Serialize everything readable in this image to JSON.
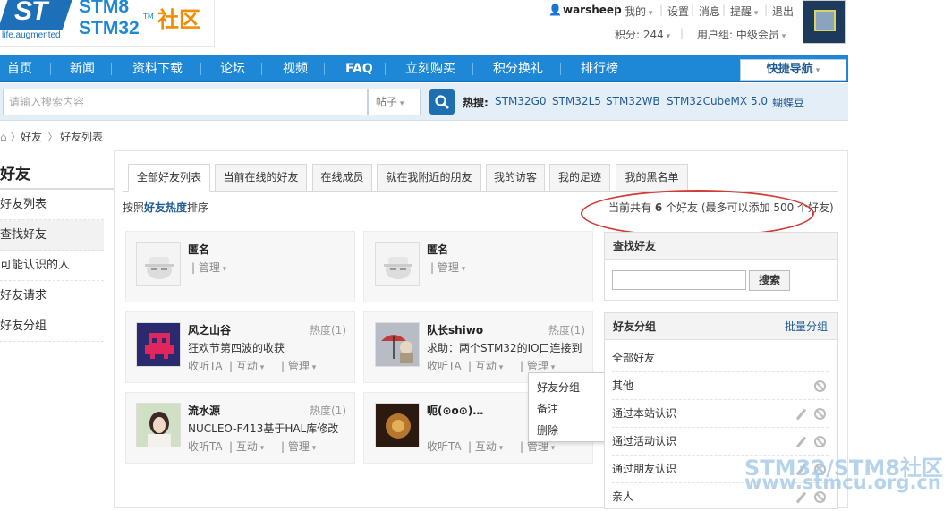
{
  "header": {
    "logo_text": "ST",
    "logo_tagline": "life.augmented",
    "brand_line1": "STM8",
    "brand_line2": "STM32",
    "brand_tm": "TM",
    "brand_cn": "社区",
    "username": "warsheep",
    "my": "我的",
    "settings": "设置",
    "messages": "消息",
    "remind": "提醒",
    "logout": "退出",
    "points": "积分: 244",
    "usergroup": "用户组: 中级会员"
  },
  "nav": {
    "items": [
      "首页",
      "新闻",
      "资料下载",
      "论坛",
      "视频",
      "FAQ",
      "立刻购买",
      "积分换礼",
      "排行榜"
    ],
    "quick": "快捷导航"
  },
  "search": {
    "placeholder": "请输入搜索内容",
    "scope": "帖子",
    "hot_label": "热搜:",
    "hot": [
      "STM32G0",
      "STM32L5",
      "STM32WB",
      "STM32CubeMX 5.0",
      "蝴蝶豆"
    ]
  },
  "breadcrumb": [
    "好友",
    "好友列表"
  ],
  "left": {
    "title": "好友",
    "items": [
      "好友列表",
      "查找好友",
      "可能认识的人",
      "好友请求",
      "好友分组"
    ]
  },
  "tabs": [
    "全部好友列表",
    "当前在线的好友",
    "在线成员",
    "就在我附近的朋友",
    "我的访客",
    "我的足迹",
    "我的黑名单"
  ],
  "sort": {
    "prefix": "按照",
    "key": "好友热度",
    "suffix": "排序"
  },
  "count": {
    "prefix": "当前共有",
    "num": "6",
    "mid": "个好友 (最多可以添加 500 个好友)"
  },
  "friends": [
    {
      "name": "匿名",
      "manage": "管理"
    },
    {
      "name": "匿名",
      "manage": "管理"
    },
    {
      "name": "风之山谷",
      "heat": "热度(1)",
      "desc": "狂欢节第四波的收获",
      "listen": "收听TA",
      "interact": "互动",
      "manage": "管理"
    },
    {
      "name": "队长shiwo",
      "heat": "热度(1)",
      "desc": "求助：两个STM32的IO口连接到",
      "listen": "收听TA",
      "interact": "互动",
      "manage": "管理"
    },
    {
      "name": "流水源",
      "heat": "热度(1)",
      "desc": "NUCLEO-F413基于HAL库修改",
      "listen": "收听TA",
      "interact": "互动",
      "manage": "管理"
    },
    {
      "name": "呃(⊙o⊙)…",
      "listen": "收听TA",
      "interact": "互动",
      "manage": "管理"
    }
  ],
  "popup": [
    "好友分组",
    "备注",
    "删除"
  ],
  "find": {
    "title": "查找好友",
    "button": "搜索",
    "value": ""
  },
  "groups": {
    "title": "好友分组",
    "batch": "批量分组",
    "items": [
      "全部好友",
      "其他",
      "通过本站认识",
      "通过活动认识",
      "通过朋友认识",
      "亲人"
    ]
  },
  "watermark": {
    "line1": "STM32/STM8社区",
    "line2": "www.stmcu.org.cn"
  }
}
